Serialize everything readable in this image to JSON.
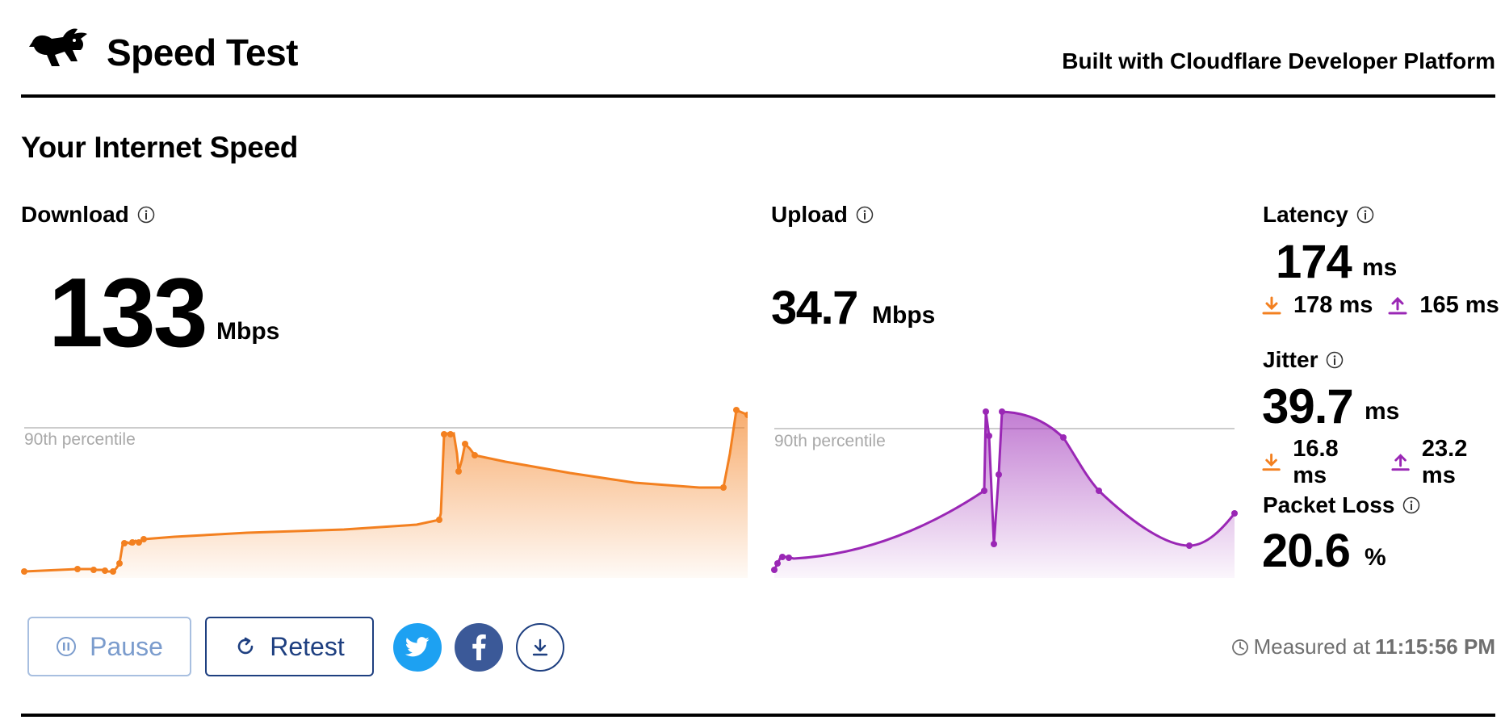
{
  "header": {
    "title": "Speed Test",
    "built_with": "Built with Cloudflare Developer Platform"
  },
  "section_title": "Your Internet Speed",
  "download": {
    "label": "Download",
    "value": "133",
    "unit": "Mbps",
    "percentile_label": "90th percentile",
    "color": "#f38020"
  },
  "upload": {
    "label": "Upload",
    "value": "34.7",
    "unit": "Mbps",
    "percentile_label": "90th percentile",
    "color": "#9a27b5"
  },
  "latency": {
    "label": "Latency",
    "value": "174",
    "unit": "ms",
    "down": "178 ms",
    "up": "165 ms"
  },
  "jitter": {
    "label": "Jitter",
    "value": "39.7",
    "unit": "ms",
    "down": "16.8 ms",
    "up": "23.2 ms"
  },
  "packet_loss": {
    "label": "Packet Loss",
    "value": "20.6",
    "unit": "%"
  },
  "controls": {
    "pause_label": "Pause",
    "retest_label": "Retest",
    "twitter_icon": "twitter-icon",
    "facebook_icon": "facebook-icon",
    "download_icon": "download-icon"
  },
  "measured": {
    "prefix": "Measured at",
    "time": "11:15:56 PM"
  },
  "colors": {
    "download": "#f38020",
    "upload": "#9a27b5",
    "button_border": "#1e3f80",
    "twitter": "#1da1f2",
    "facebook": "#3b5998"
  }
}
